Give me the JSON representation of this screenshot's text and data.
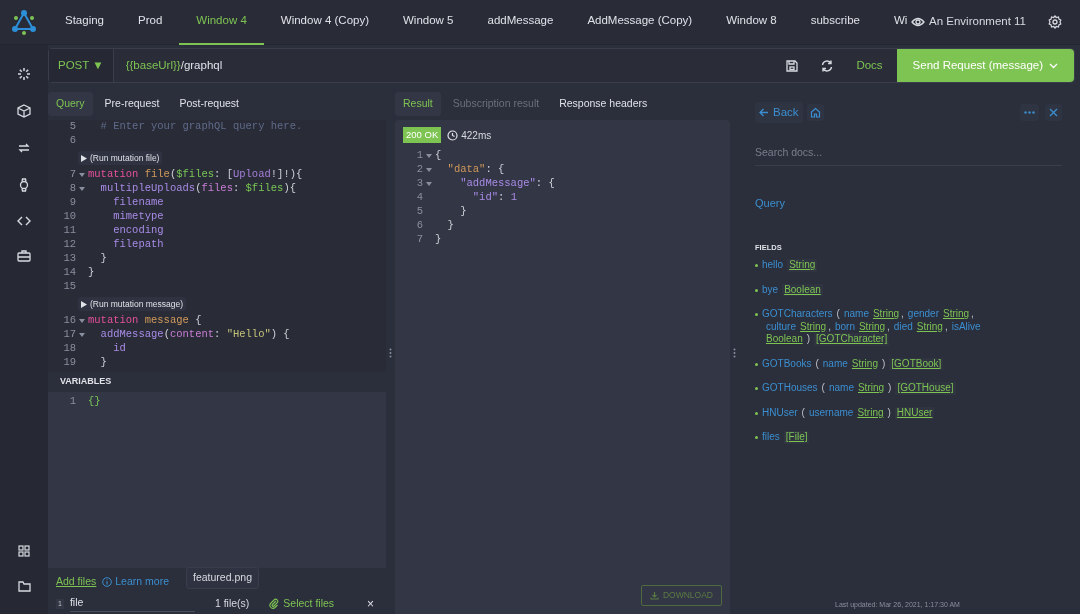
{
  "tabs": [
    {
      "label": "Staging",
      "selected": false
    },
    {
      "label": "Prod",
      "selected": false
    },
    {
      "label": "Window 4",
      "selected": true
    },
    {
      "label": "Window 4 (Copy)",
      "selected": false
    },
    {
      "label": "Window 5",
      "selected": false
    },
    {
      "label": "addMessage",
      "selected": false
    },
    {
      "label": "AddMessage (Copy)",
      "selected": false
    },
    {
      "label": "Window 8",
      "selected": false
    },
    {
      "label": "subscribe",
      "selected": false
    },
    {
      "label": "Wi",
      "selected": false
    }
  ],
  "environment": "An Environment 11",
  "request": {
    "method": "POST ▼",
    "url_variable": "{{baseUrl}}",
    "url_path": "/graphql",
    "docs": "Docs",
    "send": "Send Request (message)"
  },
  "query_tabs": [
    {
      "label": "Query",
      "selected": true
    },
    {
      "label": "Pre-request",
      "selected": false
    },
    {
      "label": "Post-request",
      "selected": false
    }
  ],
  "editor_lines": [
    {
      "kind": "code",
      "number": "5",
      "foldable": false,
      "tokens": [
        {
          "kind": "comment",
          "text": "  # Enter your graphQL query here."
        }
      ]
    },
    {
      "kind": "code",
      "number": "6",
      "foldable": false
    },
    {
      "kind": "lens",
      "text": "(Run mutation file)"
    },
    {
      "kind": "code",
      "number": "7",
      "foldable": true,
      "tokens": [
        {
          "kind": "kw",
          "text": "mutation "
        },
        {
          "kind": "name",
          "text": "file"
        },
        {
          "kind": "p",
          "text": "("
        },
        {
          "kind": "var",
          "text": "$files"
        },
        {
          "kind": "p",
          "text": ": ["
        },
        {
          "kind": "type",
          "text": "Upload"
        },
        {
          "kind": "p",
          "text": "!]!){"
        }
      ]
    },
    {
      "kind": "code",
      "number": "8",
      "foldable": true,
      "tokens": [
        {
          "kind": "field",
          "text": "  multipleUploads"
        },
        {
          "kind": "p",
          "text": "("
        },
        {
          "kind": "arg",
          "text": "files"
        },
        {
          "kind": "p",
          "text": ": "
        },
        {
          "kind": "var",
          "text": "$files"
        },
        {
          "kind": "p",
          "text": "){"
        }
      ]
    },
    {
      "kind": "code",
      "number": "9",
      "foldable": false,
      "tokens": [
        {
          "kind": "field",
          "text": "    filename"
        }
      ]
    },
    {
      "kind": "code",
      "number": "10",
      "foldable": false,
      "tokens": [
        {
          "kind": "field",
          "text": "    mimetype"
        }
      ]
    },
    {
      "kind": "code",
      "number": "11",
      "foldable": false,
      "tokens": [
        {
          "kind": "field",
          "text": "    encoding"
        }
      ]
    },
    {
      "kind": "code",
      "number": "12",
      "foldable": false,
      "tokens": [
        {
          "kind": "field",
          "text": "    filepath"
        }
      ]
    },
    {
      "kind": "code",
      "number": "13",
      "foldable": false,
      "tokens": [
        {
          "kind": "p",
          "text": "  }"
        }
      ]
    },
    {
      "kind": "code",
      "number": "14",
      "foldable": false,
      "tokens": [
        {
          "kind": "p",
          "text": "}"
        }
      ]
    },
    {
      "kind": "code",
      "number": "15",
      "foldable": false
    },
    {
      "kind": "lens",
      "text": "(Run mutation message)"
    },
    {
      "kind": "code",
      "number": "16",
      "foldable": true,
      "tokens": [
        {
          "kind": "kw",
          "text": "mutation "
        },
        {
          "kind": "name",
          "text": "message"
        },
        {
          "kind": "p",
          "text": " {"
        }
      ]
    },
    {
      "kind": "code",
      "number": "17",
      "foldable": true,
      "tokens": [
        {
          "kind": "field",
          "text": "  addMessage"
        },
        {
          "kind": "p",
          "text": "("
        },
        {
          "kind": "arg",
          "text": "content"
        },
        {
          "kind": "p",
          "text": ": "
        },
        {
          "kind": "str",
          "text": "\"Hello\""
        },
        {
          "kind": "p",
          "text": ") {"
        }
      ]
    },
    {
      "kind": "code",
      "number": "18",
      "foldable": false,
      "tokens": [
        {
          "kind": "field",
          "text": "    id"
        }
      ]
    },
    {
      "kind": "code",
      "number": "19",
      "foldable": false,
      "tokens": [
        {
          "kind": "p",
          "text": "  }"
        }
      ]
    }
  ],
  "variables": {
    "title": "VARIABLES",
    "lines": [
      {
        "number": "1",
        "tokens": [
          {
            "kind": "var",
            "text": "{}"
          }
        ]
      }
    ]
  },
  "files": {
    "add_files": "Add files",
    "learn_more": "Learn more",
    "rows": [
      {
        "number": "1",
        "name": "file",
        "count": "1 file(s)",
        "tooltip": "featured.png",
        "select": "Select files",
        "remove": "×"
      }
    ]
  },
  "result_tabs": [
    {
      "label": "Result",
      "selected": true,
      "disabled": false
    },
    {
      "label": "Subscription result",
      "selected": false,
      "disabled": true
    },
    {
      "label": "Response headers",
      "selected": false,
      "disabled": false
    }
  ],
  "response": {
    "status": "200 OK",
    "time": "422ms",
    "lines": [
      {
        "number": "1",
        "foldable": true,
        "tokens": [
          {
            "kind": "p",
            "text": "{"
          }
        ]
      },
      {
        "number": "2",
        "foldable": true,
        "tokens": [
          {
            "kind": "name",
            "text": "  \"data\""
          },
          {
            "kind": "p",
            "text": ": {"
          }
        ]
      },
      {
        "number": "3",
        "foldable": true,
        "tokens": [
          {
            "kind": "field",
            "text": "    \"addMessage\""
          },
          {
            "kind": "p",
            "text": ": {"
          }
        ]
      },
      {
        "number": "4",
        "foldable": false,
        "tokens": [
          {
            "kind": "field",
            "text": "      \"id\""
          },
          {
            "kind": "p",
            "text": ": "
          },
          {
            "kind": "field",
            "text": "1"
          }
        ]
      },
      {
        "number": "5",
        "foldable": false,
        "tokens": [
          {
            "kind": "p",
            "text": "    }"
          }
        ]
      },
      {
        "number": "6",
        "foldable": false,
        "tokens": [
          {
            "kind": "p",
            "text": "  }"
          }
        ]
      },
      {
        "number": "7",
        "foldable": false,
        "tokens": [
          {
            "kind": "p",
            "text": "}"
          }
        ]
      }
    ],
    "download": "DOWNLOAD"
  },
  "docs": {
    "back": "Back",
    "search_placeholder": "Search docs...",
    "root": "Query",
    "fields_title": "FIELDS",
    "fields": [
      [
        {
          "kind": "field",
          "text": "hello"
        },
        {
          "kind": "type",
          "text": "String"
        }
      ],
      [
        {
          "kind": "field",
          "text": "bye"
        },
        {
          "kind": "type",
          "text": "Boolean"
        }
      ],
      [
        {
          "kind": "field",
          "text": "GOTCharacters"
        },
        {
          "kind": "p",
          "text": "("
        },
        {
          "kind": "arg",
          "text": "name"
        },
        {
          "kind": "argtype",
          "text": "String"
        },
        {
          "kind": "comma",
          "text": ","
        },
        {
          "kind": "arg",
          "text": "gender"
        },
        {
          "kind": "argtype",
          "text": "String"
        },
        {
          "kind": "comma",
          "text": ","
        },
        {
          "kind": "arg",
          "text": "culture"
        },
        {
          "kind": "argtype",
          "text": "String"
        },
        {
          "kind": "comma",
          "text": ","
        },
        {
          "kind": "arg",
          "text": "born"
        },
        {
          "kind": "argtype",
          "text": "String"
        },
        {
          "kind": "comma",
          "text": ","
        },
        {
          "kind": "arg",
          "text": "died"
        },
        {
          "kind": "argtype",
          "text": "String"
        },
        {
          "kind": "comma",
          "text": ","
        },
        {
          "kind": "arg",
          "text": "isAlive"
        },
        {
          "kind": "argtype",
          "text": "Boolean"
        },
        {
          "kind": "p",
          "text": ")"
        },
        {
          "kind": "type",
          "text": "[GOTCharacter]"
        }
      ],
      [
        {
          "kind": "field",
          "text": "GOTBooks"
        },
        {
          "kind": "p",
          "text": "("
        },
        {
          "kind": "arg",
          "text": "name"
        },
        {
          "kind": "argtype",
          "text": "String"
        },
        {
          "kind": "p",
          "text": ")"
        },
        {
          "kind": "type",
          "text": "[GOTBook]"
        }
      ],
      [
        {
          "kind": "field",
          "text": "GOTHouses"
        },
        {
          "kind": "p",
          "text": "("
        },
        {
          "kind": "arg",
          "text": "name"
        },
        {
          "kind": "argtype",
          "text": "String"
        },
        {
          "kind": "p",
          "text": ")"
        },
        {
          "kind": "type",
          "text": "[GOTHouse]"
        }
      ],
      [
        {
          "kind": "field",
          "text": "HNUser"
        },
        {
          "kind": "p",
          "text": "("
        },
        {
          "kind": "arg",
          "text": "username"
        },
        {
          "kind": "argtype",
          "text": "String"
        },
        {
          "kind": "p",
          "text": ")"
        },
        {
          "kind": "type",
          "text": "HNUser"
        }
      ],
      [
        {
          "kind": "field",
          "text": "files"
        },
        {
          "kind": "type",
          "text": "[File]"
        }
      ]
    ],
    "last_updated": "Last updated: Mar 26, 2021, 1:17:30 AM"
  }
}
